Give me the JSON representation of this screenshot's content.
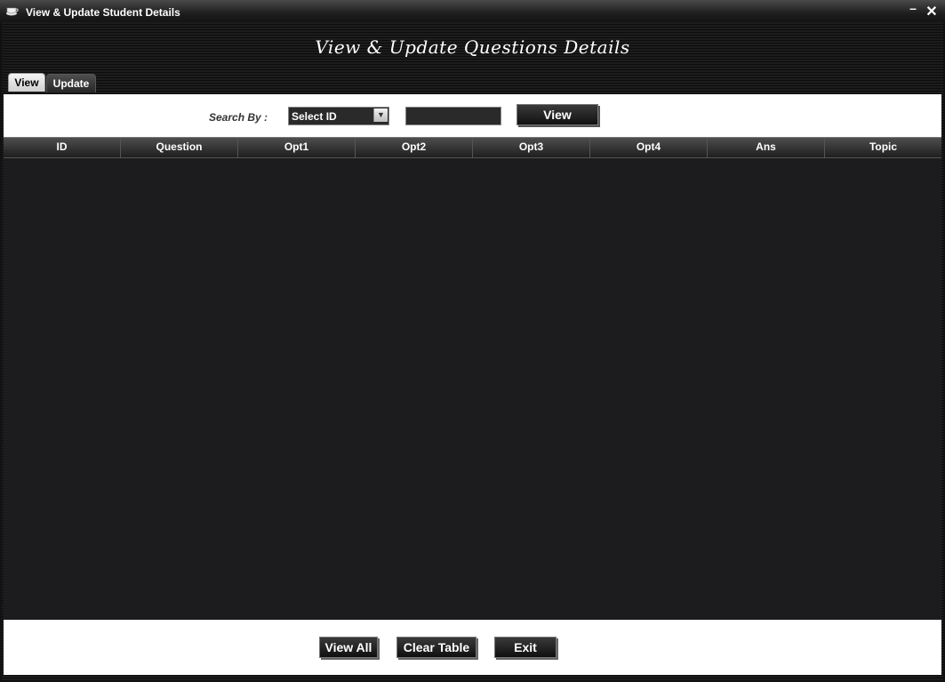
{
  "window": {
    "title": "View & Update Student Details",
    "minimize_glyph": "–",
    "close_glyph": "✕"
  },
  "heading": "View & Update Questions Details",
  "tabs": [
    {
      "label": "View",
      "selected": true
    },
    {
      "label": "Update",
      "selected": false
    }
  ],
  "search": {
    "label": "Search By :",
    "select_value": "Select ID",
    "input_value": "",
    "view_button": "View"
  },
  "table": {
    "columns": [
      "ID",
      "Question",
      "Opt1",
      "Opt2",
      "Opt3",
      "Opt4",
      "Ans",
      "Topic"
    ],
    "rows": []
  },
  "buttons": {
    "view_all": "View All",
    "clear_table": "Clear Table",
    "exit": "Exit"
  },
  "icons": {
    "app": "coffee-cup-icon",
    "dropdown": "chevron-down-icon"
  },
  "colors": {
    "background": "#111111",
    "panel": "#ffffff",
    "table_body": "#1c1c1e"
  }
}
